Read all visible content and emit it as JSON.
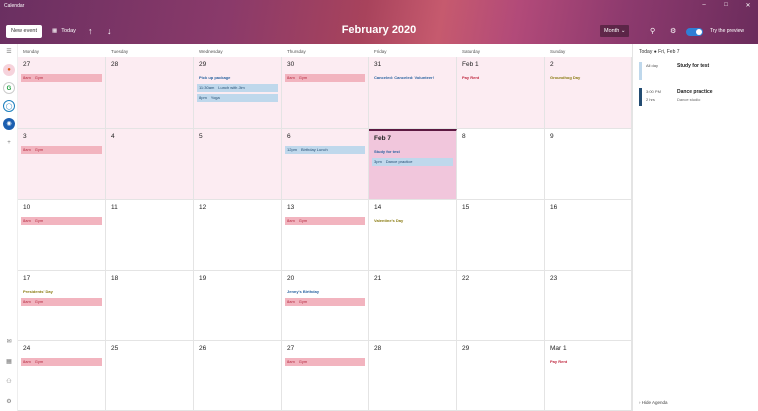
{
  "window": {
    "title": "Calendar",
    "minimize": "–",
    "maximize": "□",
    "close": "✕"
  },
  "toolbar": {
    "new_event": "New event",
    "today": "Today",
    "up_arrow": "↑",
    "down_arrow": "↓",
    "month_title": "February 2020",
    "view": "Month",
    "preview_label": "Try the preview"
  },
  "days_of_week": [
    "Monday",
    "Tuesday",
    "Wednesday",
    "Thursday",
    "Friday",
    "Saturday",
    "Sunday"
  ],
  "weeks": [
    [
      {
        "num": "27",
        "bg": "pink",
        "events": [
          {
            "kind": "red",
            "time": "8am",
            "title": "Gym"
          }
        ]
      },
      {
        "num": "28",
        "bg": "pink",
        "events": []
      },
      {
        "num": "29",
        "bg": "pink",
        "events": [
          {
            "kind": "plain-blue",
            "time": "",
            "title": "Pick up package"
          },
          {
            "kind": "blue",
            "time": "11:30am",
            "title": "Lunch with Jim"
          },
          {
            "kind": "blue",
            "time": "8pm",
            "title": "Yoga"
          }
        ]
      },
      {
        "num": "30",
        "bg": "pink",
        "events": [
          {
            "kind": "red",
            "time": "8am",
            "title": "Gym"
          }
        ]
      },
      {
        "num": "31",
        "bg": "pink",
        "events": [
          {
            "kind": "plain-blue",
            "time": "",
            "title": "Canceled: Canceled: Volunteer!"
          }
        ]
      },
      {
        "num": "Feb 1",
        "bg": "pink",
        "events": [
          {
            "kind": "plain-red",
            "time": "",
            "title": "Pay Rent"
          }
        ]
      },
      {
        "num": "2",
        "bg": "pink",
        "events": [
          {
            "kind": "plain-olive",
            "time": "",
            "title": "Groundhog Day"
          }
        ]
      }
    ],
    [
      {
        "num": "3",
        "bg": "pink",
        "events": [
          {
            "kind": "red",
            "time": "8am",
            "title": "Gym"
          }
        ]
      },
      {
        "num": "4",
        "bg": "pink",
        "events": []
      },
      {
        "num": "5",
        "bg": "pink",
        "events": []
      },
      {
        "num": "6",
        "bg": "pink",
        "events": [
          {
            "kind": "blue",
            "time": "12pm",
            "title": "Birthday Lunch"
          }
        ]
      },
      {
        "num": "Feb 7",
        "bg": "sel",
        "events": [
          {
            "kind": "plain-blue",
            "time": "",
            "title": "Study for test"
          },
          {
            "kind": "blue",
            "time": "3pm",
            "title": "Dance practice"
          }
        ]
      },
      {
        "num": "8",
        "bg": "white",
        "events": []
      },
      {
        "num": "9",
        "bg": "white",
        "events": []
      }
    ],
    [
      {
        "num": "10",
        "bg": "white",
        "events": [
          {
            "kind": "red",
            "time": "8am",
            "title": "Gym"
          }
        ]
      },
      {
        "num": "11",
        "bg": "white",
        "events": []
      },
      {
        "num": "12",
        "bg": "white",
        "events": []
      },
      {
        "num": "13",
        "bg": "white",
        "events": [
          {
            "kind": "red",
            "time": "8am",
            "title": "Gym"
          }
        ]
      },
      {
        "num": "14",
        "bg": "white",
        "events": [
          {
            "kind": "plain-olive",
            "time": "",
            "title": "Valentine's Day"
          }
        ]
      },
      {
        "num": "15",
        "bg": "white",
        "events": []
      },
      {
        "num": "16",
        "bg": "white",
        "events": []
      }
    ],
    [
      {
        "num": "17",
        "bg": "white",
        "events": [
          {
            "kind": "plain-olive",
            "time": "",
            "title": "Presidents' Day"
          },
          {
            "kind": "red",
            "time": "8am",
            "title": "Gym"
          }
        ]
      },
      {
        "num": "18",
        "bg": "white",
        "events": []
      },
      {
        "num": "19",
        "bg": "white",
        "events": []
      },
      {
        "num": "20",
        "bg": "white",
        "events": [
          {
            "kind": "plain-blue",
            "time": "",
            "title": "Jenny's Birthday"
          },
          {
            "kind": "red",
            "time": "8am",
            "title": "Gym"
          }
        ]
      },
      {
        "num": "21",
        "bg": "white",
        "events": []
      },
      {
        "num": "22",
        "bg": "white",
        "events": []
      },
      {
        "num": "23",
        "bg": "white",
        "events": []
      }
    ],
    [
      {
        "num": "24",
        "bg": "white",
        "events": [
          {
            "kind": "red",
            "time": "8am",
            "title": "Gym"
          }
        ]
      },
      {
        "num": "25",
        "bg": "white",
        "events": []
      },
      {
        "num": "26",
        "bg": "white",
        "events": []
      },
      {
        "num": "27",
        "bg": "white",
        "events": [
          {
            "kind": "red",
            "time": "8am",
            "title": "Gym"
          }
        ]
      },
      {
        "num": "28",
        "bg": "white",
        "events": []
      },
      {
        "num": "29",
        "bg": "white",
        "events": []
      },
      {
        "num": "Mar 1",
        "bg": "white",
        "events": [
          {
            "kind": "plain-red",
            "time": "",
            "title": "Pay Rent"
          }
        ]
      }
    ]
  ],
  "agenda": {
    "header": "Today ● Fri, Feb 7",
    "items": [
      {
        "time": "All day",
        "duration": "",
        "title": "Study for test",
        "subtitle": "",
        "color": "#bfd8ec"
      },
      {
        "time": "3:00 PM",
        "duration": "2 hrs",
        "title": "Dance practice",
        "subtitle": "Dance studio",
        "color": "#234c72"
      }
    ],
    "hide_label": "Hide Agenda"
  },
  "colors": {
    "accent": "#2f7fd6",
    "selected_day": "#f1c6dc",
    "gym_event": "#f2b4bf",
    "blue_event": "#bfd8ec"
  }
}
